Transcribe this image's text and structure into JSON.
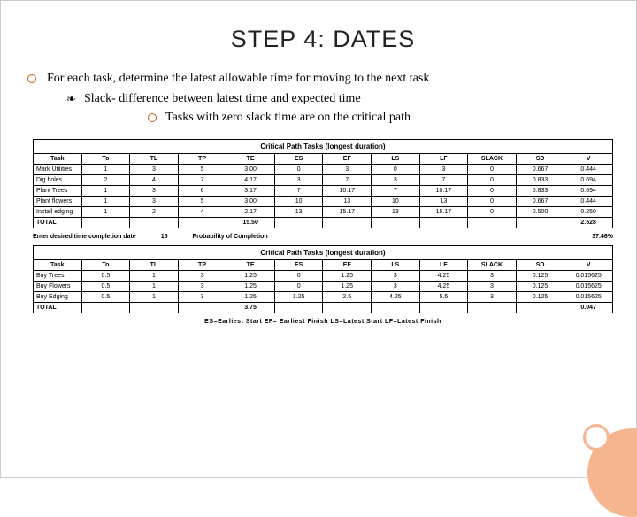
{
  "title": "STEP 4: DATES",
  "bullets": {
    "main": "For each task, determine the latest allowable time for moving to the next task",
    "sub1": "Slack- difference between latest time and expected time",
    "sub2": "Tasks with zero slack time are on the critical path"
  },
  "table1": {
    "caption": "Critical Path Tasks (longest duration)",
    "headers": [
      "Task",
      "To",
      "TL",
      "TP",
      "TE",
      "ES",
      "EF",
      "LS",
      "LF",
      "SLACK",
      "SD",
      "V"
    ],
    "rows": [
      [
        "Mark Utilities",
        "1",
        "3",
        "5",
        "3.00",
        "0",
        "3",
        "0",
        "3",
        "0",
        "0.667",
        "0.444"
      ],
      [
        "Dig holes",
        "2",
        "4",
        "7",
        "4.17",
        "3",
        "7",
        "3",
        "7",
        "0",
        "0.833",
        "0.694"
      ],
      [
        "Plant Trees",
        "1",
        "3",
        "6",
        "3.17",
        "7",
        "10.17",
        "7",
        "10.17",
        "0",
        "0.833",
        "0.694"
      ],
      [
        "Plant flowers",
        "1",
        "3",
        "5",
        "3.00",
        "10",
        "13",
        "10",
        "13",
        "0",
        "0.667",
        "0.444"
      ],
      [
        "Install edging",
        "1",
        "2",
        "4",
        "2.17",
        "13",
        "15.17",
        "13",
        "15.17",
        "0",
        "0.500",
        "0.250"
      ]
    ],
    "total_label": "TOTAL",
    "total_te_sum": "15.50",
    "total_v": "2.528"
  },
  "meta": {
    "label1": "Enter desired time completion date",
    "val1": "15",
    "label2": "Probability of Completion",
    "val2": "37.46%"
  },
  "table2": {
    "caption": "Critical Path Tasks (longest duration)",
    "headers": [
      "Task",
      "To",
      "TL",
      "TP",
      "TE",
      "ES",
      "EF",
      "LS",
      "LF",
      "SLACK",
      "SD",
      "V"
    ],
    "rows": [
      [
        "Buy Trees",
        "0.5",
        "1",
        "3",
        "1.25",
        "0",
        "1.25",
        "3",
        "4.25",
        "3",
        "0.125",
        "0.015625"
      ],
      [
        "Buy Flowers",
        "0.5",
        "1",
        "3",
        "1.25",
        "0",
        "1.25",
        "3",
        "4.25",
        "3",
        "0.125",
        "0.015625"
      ],
      [
        "Buy Edging",
        "0.5",
        "1",
        "3",
        "1.25",
        "1.25",
        "2.5",
        "4.25",
        "5.5",
        "3",
        "0.125",
        "0.015625"
      ]
    ],
    "total_label": "TOTAL",
    "total_te_sum": "3.75",
    "total_v": "0.047"
  },
  "footnote": "ES=Earliest Start EF=  Earliest Finish   LS=Latest Start   LF=Latest Finish",
  "chart_data": [
    {
      "type": "table",
      "title": "Critical Path Tasks (longest duration)",
      "columns": [
        "Task",
        "To",
        "TL",
        "TP",
        "TE",
        "ES",
        "EF",
        "LS",
        "LF",
        "SLACK",
        "SD",
        "V"
      ],
      "rows": [
        {
          "Task": "Mark Utilities",
          "To": 1,
          "TL": 3,
          "TP": 5,
          "TE": 3.0,
          "ES": 0,
          "EF": 3,
          "LS": 0,
          "LF": 3,
          "SLACK": 0,
          "SD": 0.667,
          "V": 0.444
        },
        {
          "Task": "Dig holes",
          "To": 2,
          "TL": 4,
          "TP": 7,
          "TE": 4.17,
          "ES": 3,
          "EF": 7,
          "LS": 3,
          "LF": 7,
          "SLACK": 0,
          "SD": 0.833,
          "V": 0.694
        },
        {
          "Task": "Plant Trees",
          "To": 1,
          "TL": 3,
          "TP": 6,
          "TE": 3.17,
          "ES": 7,
          "EF": 10.17,
          "LS": 7,
          "LF": 10.17,
          "SLACK": 0,
          "SD": 0.833,
          "V": 0.694
        },
        {
          "Task": "Plant flowers",
          "To": 1,
          "TL": 3,
          "TP": 5,
          "TE": 3.0,
          "ES": 10,
          "EF": 13,
          "LS": 10,
          "LF": 13,
          "SLACK": 0,
          "SD": 0.667,
          "V": 0.444
        },
        {
          "Task": "Install edging",
          "To": 1,
          "TL": 2,
          "TP": 4,
          "TE": 2.17,
          "ES": 13,
          "EF": 15.17,
          "LS": 13,
          "LF": 15.17,
          "SLACK": 0,
          "SD": 0.5,
          "V": 0.25
        }
      ],
      "totals": {
        "TE_sum": 15.5,
        "V_sum": 2.528
      }
    },
    {
      "type": "table",
      "title": "Critical Path Tasks (longest duration)",
      "columns": [
        "Task",
        "To",
        "TL",
        "TP",
        "TE",
        "ES",
        "EF",
        "LS",
        "LF",
        "SLACK",
        "SD",
        "V"
      ],
      "rows": [
        {
          "Task": "Buy Trees",
          "To": 0.5,
          "TL": 1,
          "TP": 3,
          "TE": 1.25,
          "ES": 0,
          "EF": 1.25,
          "LS": 3,
          "LF": 4.25,
          "SLACK": 3,
          "SD": 0.125,
          "V": 0.015625
        },
        {
          "Task": "Buy Flowers",
          "To": 0.5,
          "TL": 1,
          "TP": 3,
          "TE": 1.25,
          "ES": 0,
          "EF": 1.25,
          "LS": 3,
          "LF": 4.25,
          "SLACK": 3,
          "SD": 0.125,
          "V": 0.015625
        },
        {
          "Task": "Buy Edging",
          "To": 0.5,
          "TL": 1,
          "TP": 3,
          "TE": 1.25,
          "ES": 1.25,
          "EF": 2.5,
          "LS": 4.25,
          "LF": 5.5,
          "SLACK": 3,
          "SD": 0.125,
          "V": 0.015625
        }
      ],
      "totals": {
        "TE_sum": 3.75,
        "V_sum": 0.047
      }
    }
  ]
}
